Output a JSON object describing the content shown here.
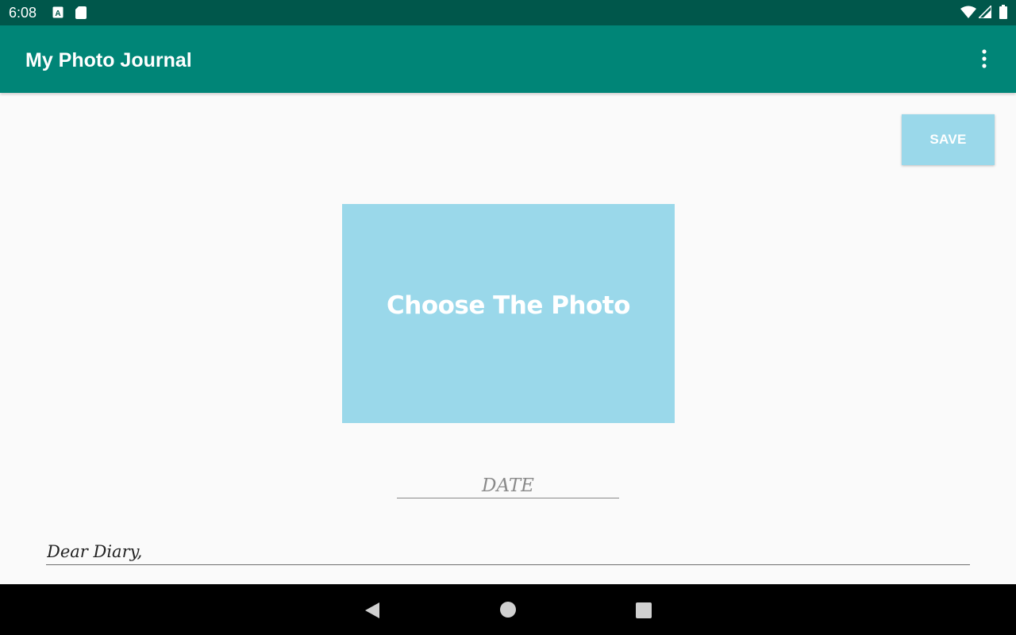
{
  "status_bar": {
    "time": "6:08",
    "left_icons": [
      "keyboard-a-icon",
      "sd-card-icon"
    ],
    "right_icons": [
      "wifi-icon",
      "cellular-signal-icon",
      "battery-icon"
    ]
  },
  "app_bar": {
    "title": "My Photo Journal",
    "menu_icon": "overflow-menu-icon"
  },
  "toolbar": {
    "save_label": "SAVE"
  },
  "photo": {
    "label": "Choose The Photo"
  },
  "date": {
    "placeholder": "DATE",
    "value": ""
  },
  "diary": {
    "placeholder": "Dear Diary,",
    "value": ""
  },
  "nav_bar": {
    "icons": [
      "back-icon",
      "home-icon",
      "recents-icon"
    ]
  },
  "colors": {
    "status_bar": "#00574b",
    "app_bar": "#008577",
    "accent_light_blue": "#9ad8ea",
    "background": "#fafafa",
    "nav_bar": "#000000"
  }
}
